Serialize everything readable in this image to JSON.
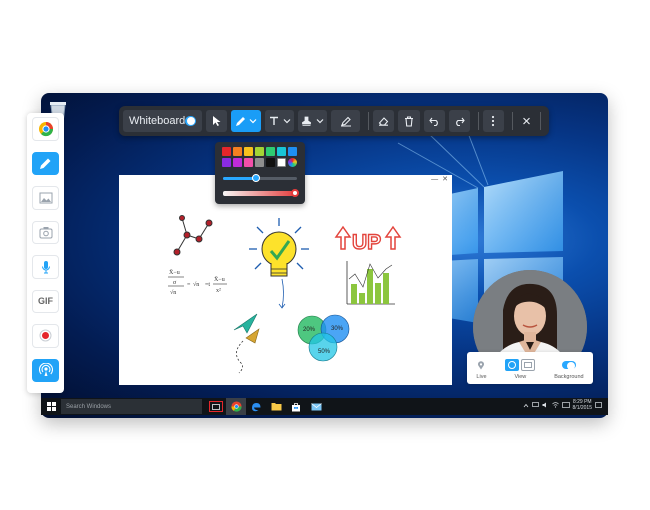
{
  "toolbar": {
    "whiteboard_label": "Whiteboard",
    "whiteboard_toggle_on": true,
    "items": [
      "cursor-icon",
      "pen-icon",
      "text-icon",
      "stamp-icon",
      "highlighter-icon",
      "eraser-icon",
      "trash-icon",
      "undo-icon",
      "redo-icon",
      "more-icon",
      "close-icon"
    ],
    "close_glyph": "×"
  },
  "palette": {
    "colors_row1": [
      "#e5262b",
      "#f47f20",
      "#f8c21c",
      "#a3d435",
      "#2ecc71",
      "#18c5d6",
      "#1e8ff2"
    ],
    "colors_row2": [
      "#8a2be2",
      "#c02bd8",
      "#f24fa9",
      "#8e8e8e",
      "#111111",
      "#ffffff",
      "#multicolor"
    ],
    "size_level": 0.45,
    "opacity_level": 1.0
  },
  "whiteboard": {
    "window_min": "—",
    "window_close": "✕",
    "drawing_text": {
      "up": "UP",
      "pct1": "20%",
      "pct2": "30%",
      "pct3": "50%"
    }
  },
  "sidebar": {
    "items": [
      "screen-record-icon",
      "pen-icon",
      "image-icon",
      "screenshot-icon",
      "microphone-icon",
      "gif-icon",
      "record-icon",
      "live-broadcast-icon"
    ],
    "gif_label": "GIF"
  },
  "webcam_panel": {
    "live_label": "Live",
    "view_label": "View",
    "background_label": "Background"
  },
  "taskbar": {
    "search_placeholder": "Search Windows",
    "time": "8:29 PM",
    "date": "8/1/2015"
  },
  "colors": {
    "accent": "#21a3f7",
    "toolbar_bg": "#2b2f36"
  }
}
